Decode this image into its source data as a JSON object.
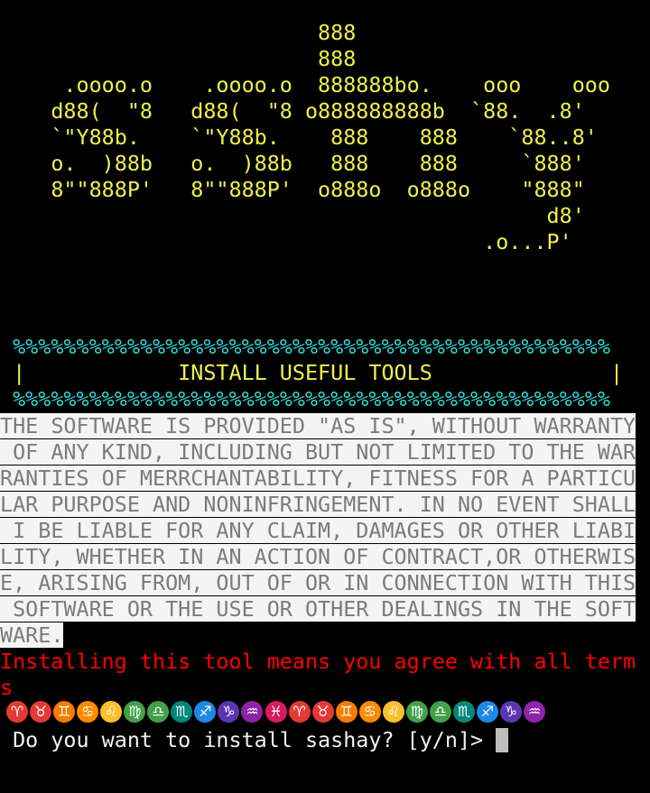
{
  "banner_lines": [
    "                         888",
    "                         888",
    "     .oooo.o    .oooo.o  888888bo.    ooo    ooo",
    "    d88(  \"8   d88(  \"8 o888888888b  `88.  .8'",
    "    `\"Y88b.    `\"Y88b.    888    888    `88..8'",
    "    o.  )88b   o.  )88b   888    888     `888'",
    "    8\"\"888P'   8\"\"888P'  o888o  o888o    \"888\"",
    "                                           d8'",
    "                                      .o...P'"
  ],
  "frame": {
    "top": " %%%%%%%%%%%%%%%%%%%%%%%%%%%%%%%%%%%%%%%%%%%%%%%",
    "title": " |            INSTALL USEFUL TOOLS              |",
    "bottom": " %%%%%%%%%%%%%%%%%%%%%%%%%%%%%%%%%%%%%%%%%%%%%%%"
  },
  "license_lines": [
    "THE SOFTWARE IS PROVIDED \"AS IS\", WITHOUT WARRANTY",
    " OF ANY KIND, INCLUDING BUT NOT LIMITED TO THE WAR",
    "RANTIES OF MERRCHANTABILITY, FITNESS FOR A PARTICU",
    "LAR PURPOSE AND NONINFRINGEMENT. IN NO EVENT SHALL",
    " I BE LIABLE FOR ANY CLAIM, DAMAGES OR OTHER LIABI",
    "LITY, WHETHER IN AN ACTION OF CONTRACT,OR OTHERWIS",
    "E, ARISING FROM, OUT OF OR IN CONNECTION WITH THIS",
    " SOFTWARE OR THE USE OR OTHER DEALINGS IN THE SOFT",
    "WARE."
  ],
  "agreement_lines": [
    "Installing this tool means you agree with all term",
    "s"
  ],
  "zodiac": [
    {
      "symbol": "♈",
      "name": "aries-icon",
      "color": "#e53935"
    },
    {
      "symbol": "♉",
      "name": "taurus-icon",
      "color": "#e53935"
    },
    {
      "symbol": "♊",
      "name": "gemini-icon",
      "color": "#f57c00"
    },
    {
      "symbol": "♋",
      "name": "cancer-icon",
      "color": "#fb8c00"
    },
    {
      "symbol": "♌",
      "name": "leo-icon",
      "color": "#fbc02d"
    },
    {
      "symbol": "♍",
      "name": "virgo-icon",
      "color": "#43a047"
    },
    {
      "symbol": "♎",
      "name": "libra-icon",
      "color": "#43a047"
    },
    {
      "symbol": "♏",
      "name": "scorpio-icon",
      "color": "#00897b"
    },
    {
      "symbol": "♐",
      "name": "sagittarius-icon",
      "color": "#1e88e5"
    },
    {
      "symbol": "♑",
      "name": "capricorn-icon",
      "color": "#5e35b1"
    },
    {
      "symbol": "♒",
      "name": "aquarius-icon",
      "color": "#8e24aa"
    },
    {
      "symbol": "♓",
      "name": "pisces-icon",
      "color": "#d81b60"
    },
    {
      "symbol": "♈",
      "name": "aries-icon",
      "color": "#e53935"
    },
    {
      "symbol": "♉",
      "name": "taurus-icon",
      "color": "#e53935"
    },
    {
      "symbol": "♊",
      "name": "gemini-icon",
      "color": "#f57c00"
    },
    {
      "symbol": "♋",
      "name": "cancer-icon",
      "color": "#fb8c00"
    },
    {
      "symbol": "♌",
      "name": "leo-icon",
      "color": "#fbc02d"
    },
    {
      "symbol": "♍",
      "name": "virgo-icon",
      "color": "#43a047"
    },
    {
      "symbol": "♎",
      "name": "libra-icon",
      "color": "#43a047"
    },
    {
      "symbol": "♏",
      "name": "scorpio-icon",
      "color": "#00897b"
    },
    {
      "symbol": "♐",
      "name": "sagittarius-icon",
      "color": "#1e88e5"
    },
    {
      "symbol": "♑",
      "name": "capricorn-icon",
      "color": "#5e35b1"
    },
    {
      "symbol": "♒",
      "name": "aquarius-icon",
      "color": "#8e24aa"
    }
  ],
  "prompt": " Do you want to install sashay? [y/n]> ",
  "colors": {
    "background": "#000000",
    "banner": "#f1f14a",
    "frame_border": "#30d5d5",
    "warning": "#ff0000",
    "prompt": "#f2f2f2"
  }
}
